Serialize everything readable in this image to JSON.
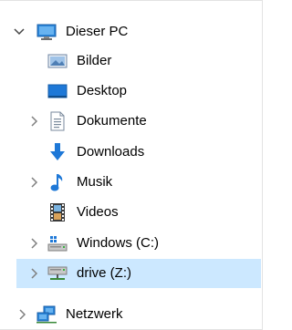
{
  "tree": {
    "root": {
      "label": "Dieser PC",
      "expanded": true,
      "icon": "computer-icon"
    },
    "children": [
      {
        "label": "Bilder",
        "icon": "pictures-icon",
        "expandable": false
      },
      {
        "label": "Desktop",
        "icon": "desktop-icon",
        "expandable": false
      },
      {
        "label": "Dokumente",
        "icon": "documents-icon",
        "expandable": true
      },
      {
        "label": "Downloads",
        "icon": "downloads-icon",
        "expandable": false
      },
      {
        "label": "Musik",
        "icon": "music-icon",
        "expandable": true
      },
      {
        "label": "Videos",
        "icon": "videos-icon",
        "expandable": false
      },
      {
        "label": "Windows (C:)",
        "icon": "windows-drive-icon",
        "expandable": true
      },
      {
        "label": "drive  (Z:)",
        "icon": "network-drive-icon",
        "expandable": true,
        "selected": true
      }
    ],
    "network": {
      "label": "Netzwerk",
      "icon": "network-icon",
      "expandable": true
    }
  },
  "colors": {
    "selection": "#cce8ff",
    "accent": "#1e78d7",
    "chevron": "#808080"
  }
}
